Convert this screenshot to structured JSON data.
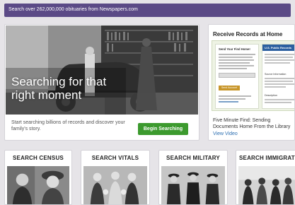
{
  "banner": {
    "text": "Search over 262,000,000 obituaries from Newspapers.com"
  },
  "hero": {
    "title": "Searching for that right moment",
    "description": "Start searching billions of records and discover your family's story.",
    "button_label": "Begin Searching"
  },
  "records_panel": {
    "title": "Receive Records at Home",
    "promo": {
      "form_title": "Send Your Find Home!",
      "form_button": "Send Account",
      "side_header": "U.S. Public Records",
      "side_label_1": "Source Information",
      "side_label_2": "Description"
    },
    "description": "Five Minute Find: Sending Documents Home From the Library",
    "link_label": "View Video"
  },
  "categories": [
    {
      "label": "SEARCH CENSUS"
    },
    {
      "label": "SEARCH VITALS"
    },
    {
      "label": "SEARCH MILITARY"
    },
    {
      "label": "SEARCH IMMIGRATION"
    }
  ],
  "colors": {
    "banner_bg": "#5b4a86",
    "button_green": "#3c9a2e",
    "link_blue": "#2a6db0",
    "page_bg": "#e6e4e8"
  }
}
